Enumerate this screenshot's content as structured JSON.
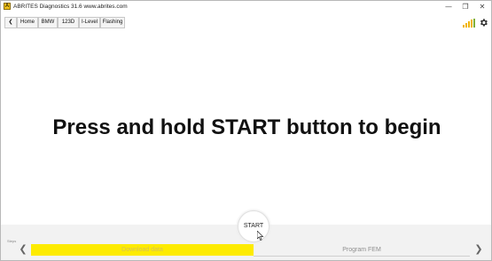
{
  "window": {
    "title": "ABRITES Diagnostics 31.6  www.abrites.com",
    "app_icon_letter": "A",
    "controls": {
      "minimize": "—",
      "maximize": "❐",
      "close": "✕"
    }
  },
  "nav": {
    "back": "❮",
    "breadcrumbs": [
      "Home",
      "BMW",
      "123D",
      "I-Level",
      "Flashing"
    ]
  },
  "toolbar": {
    "signal_icon": "signal-bars-icon",
    "settings_icon": "gear-icon",
    "signal_color": "#f0b400"
  },
  "main": {
    "prompt": "Press and hold START button to begin"
  },
  "start": {
    "label": "START"
  },
  "steps": {
    "label": "Steps",
    "prev": "❮",
    "next": "❯",
    "items": [
      {
        "label": "Download data",
        "state": "active",
        "color": "#fdeb00"
      },
      {
        "label": "Program FEM",
        "state": "pending"
      }
    ]
  }
}
